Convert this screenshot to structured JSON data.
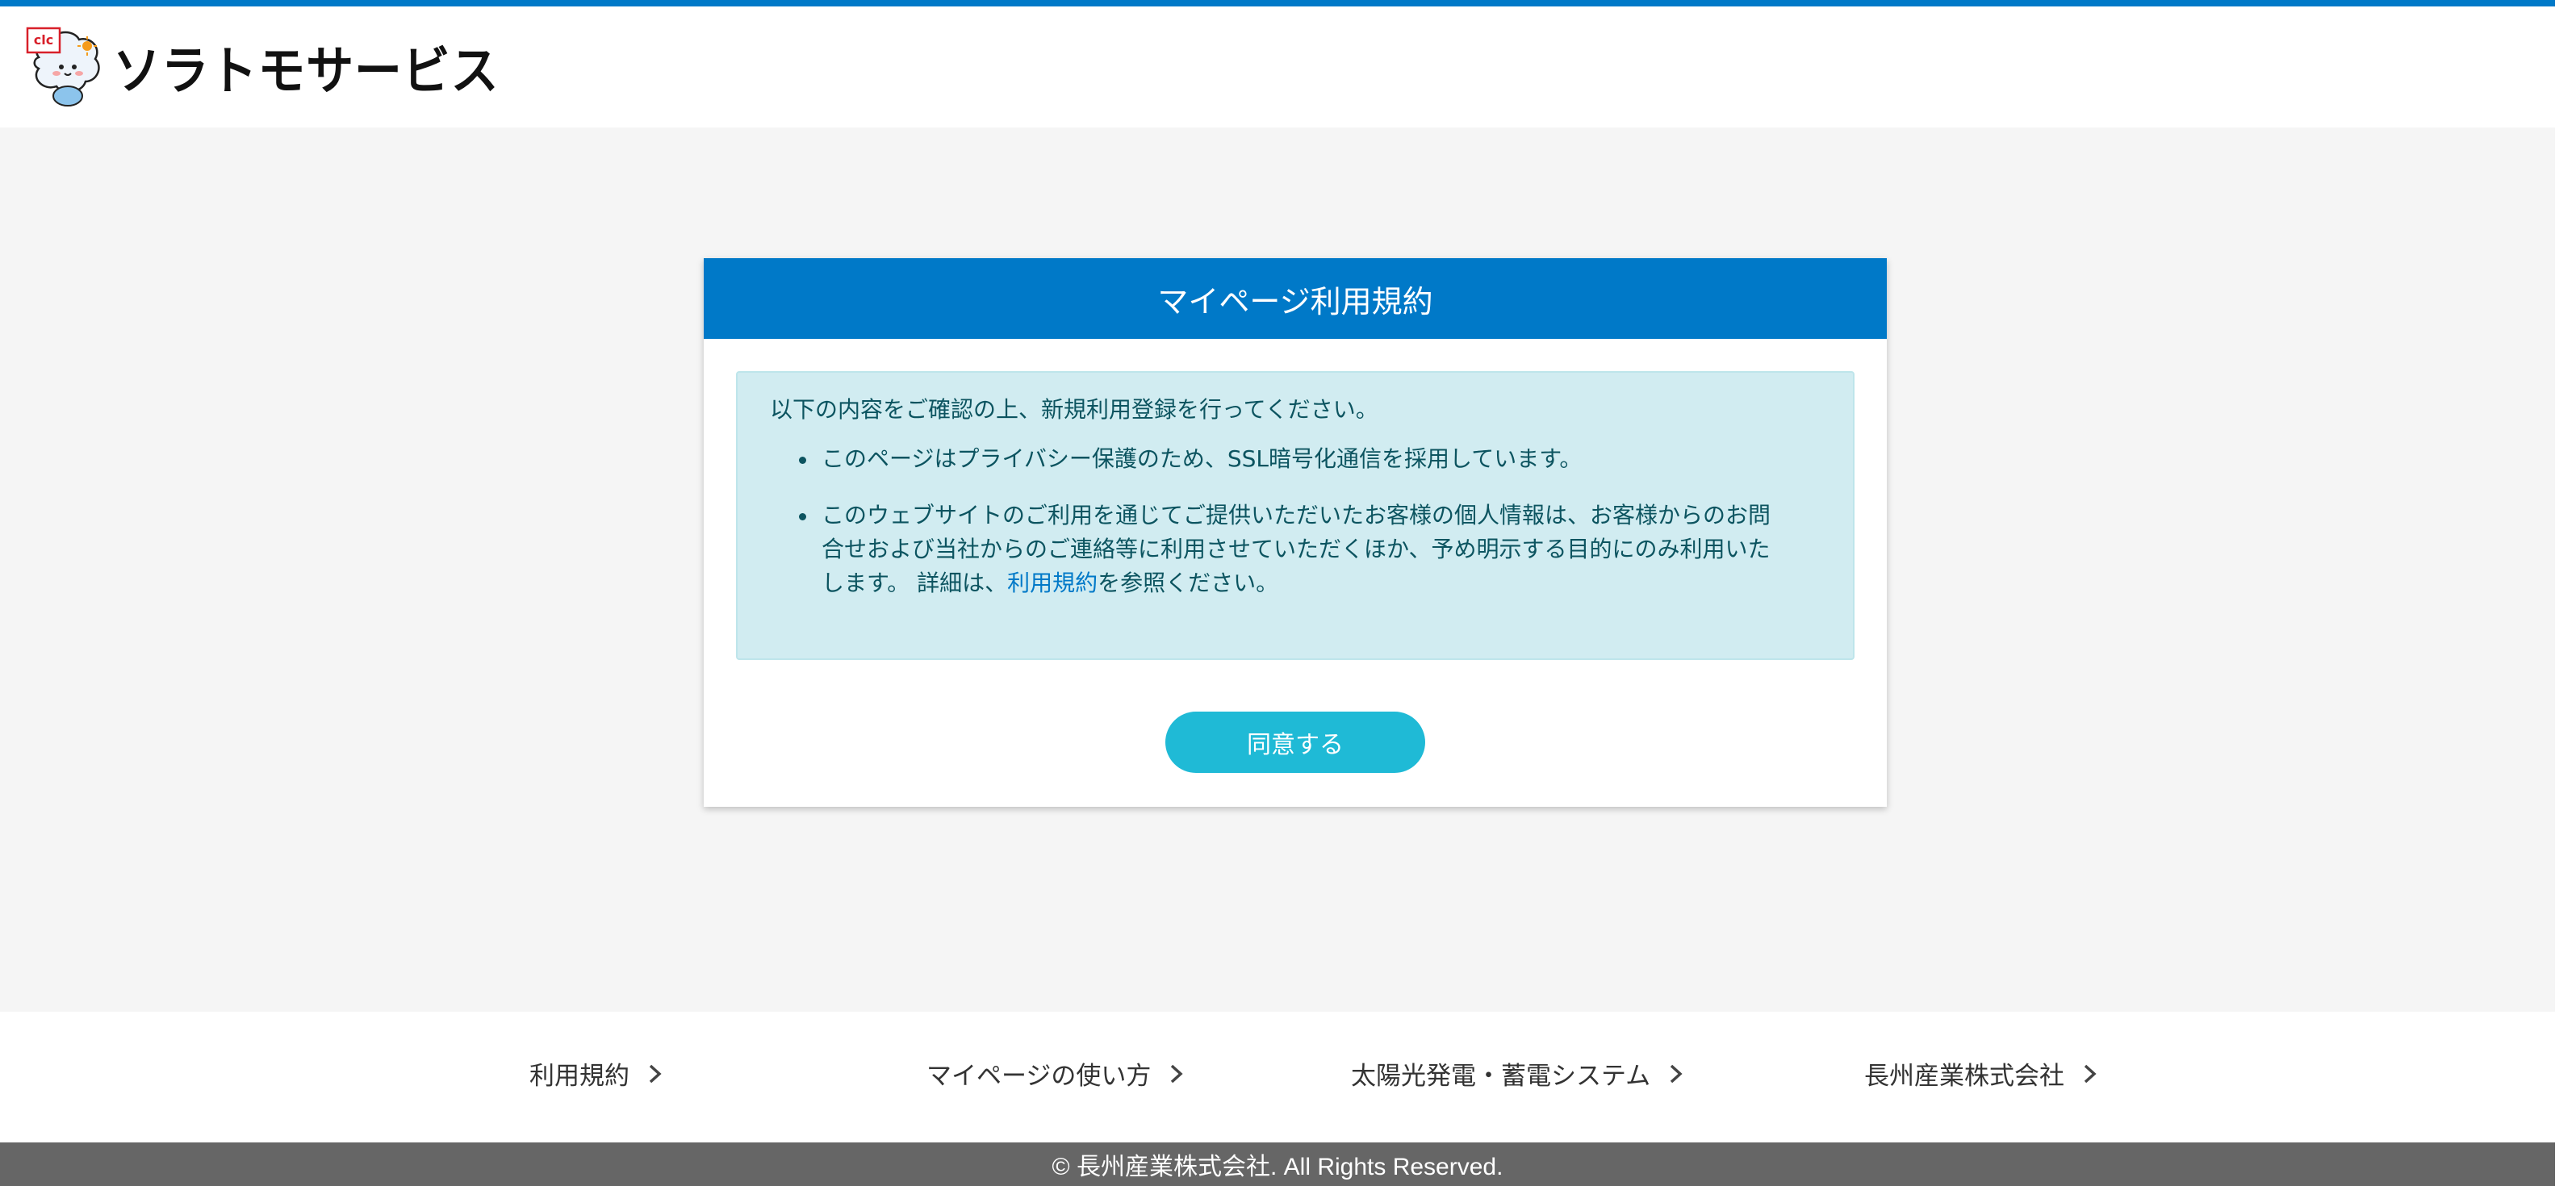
{
  "header": {
    "mascot_badge": "clc",
    "brand": "ソラトモサービス"
  },
  "card": {
    "title": "マイページ利用規約",
    "intro": "以下の内容をご確認の上、新規利用登録を行ってください。",
    "bullet1": "このページはプライバシー保護のため、SSL暗号化通信を採用しています。",
    "bullet2_line1": "このウェブサイトのご利用を通じてご提供いただいたお客様の個人情報は、お客様からのお問",
    "bullet2_line2": "合せおよび当社からのご連絡等に利用させていただくほか、予め明示する目的にのみ利用いた",
    "bullet2_line3_before": "します。 詳細は、",
    "bullet2_link": "利用規約",
    "bullet2_after": "を参照ください。",
    "agree_button": "同意する"
  },
  "footer": {
    "links": [
      "利用規約",
      "マイページの使い方",
      "太陽光発電・蓄電システム",
      "長州産業株式会社"
    ],
    "copyright": "© 長州産業株式会社. All Rights Reserved."
  },
  "colors": {
    "primary": "#0079c8",
    "button": "#1fbad6",
    "info_bg": "#d1ecf1",
    "info_text": "#0c5460",
    "footer_bar": "#666666"
  },
  "icons": [
    "mascot-logo-icon",
    "chevron-right-icon"
  ]
}
